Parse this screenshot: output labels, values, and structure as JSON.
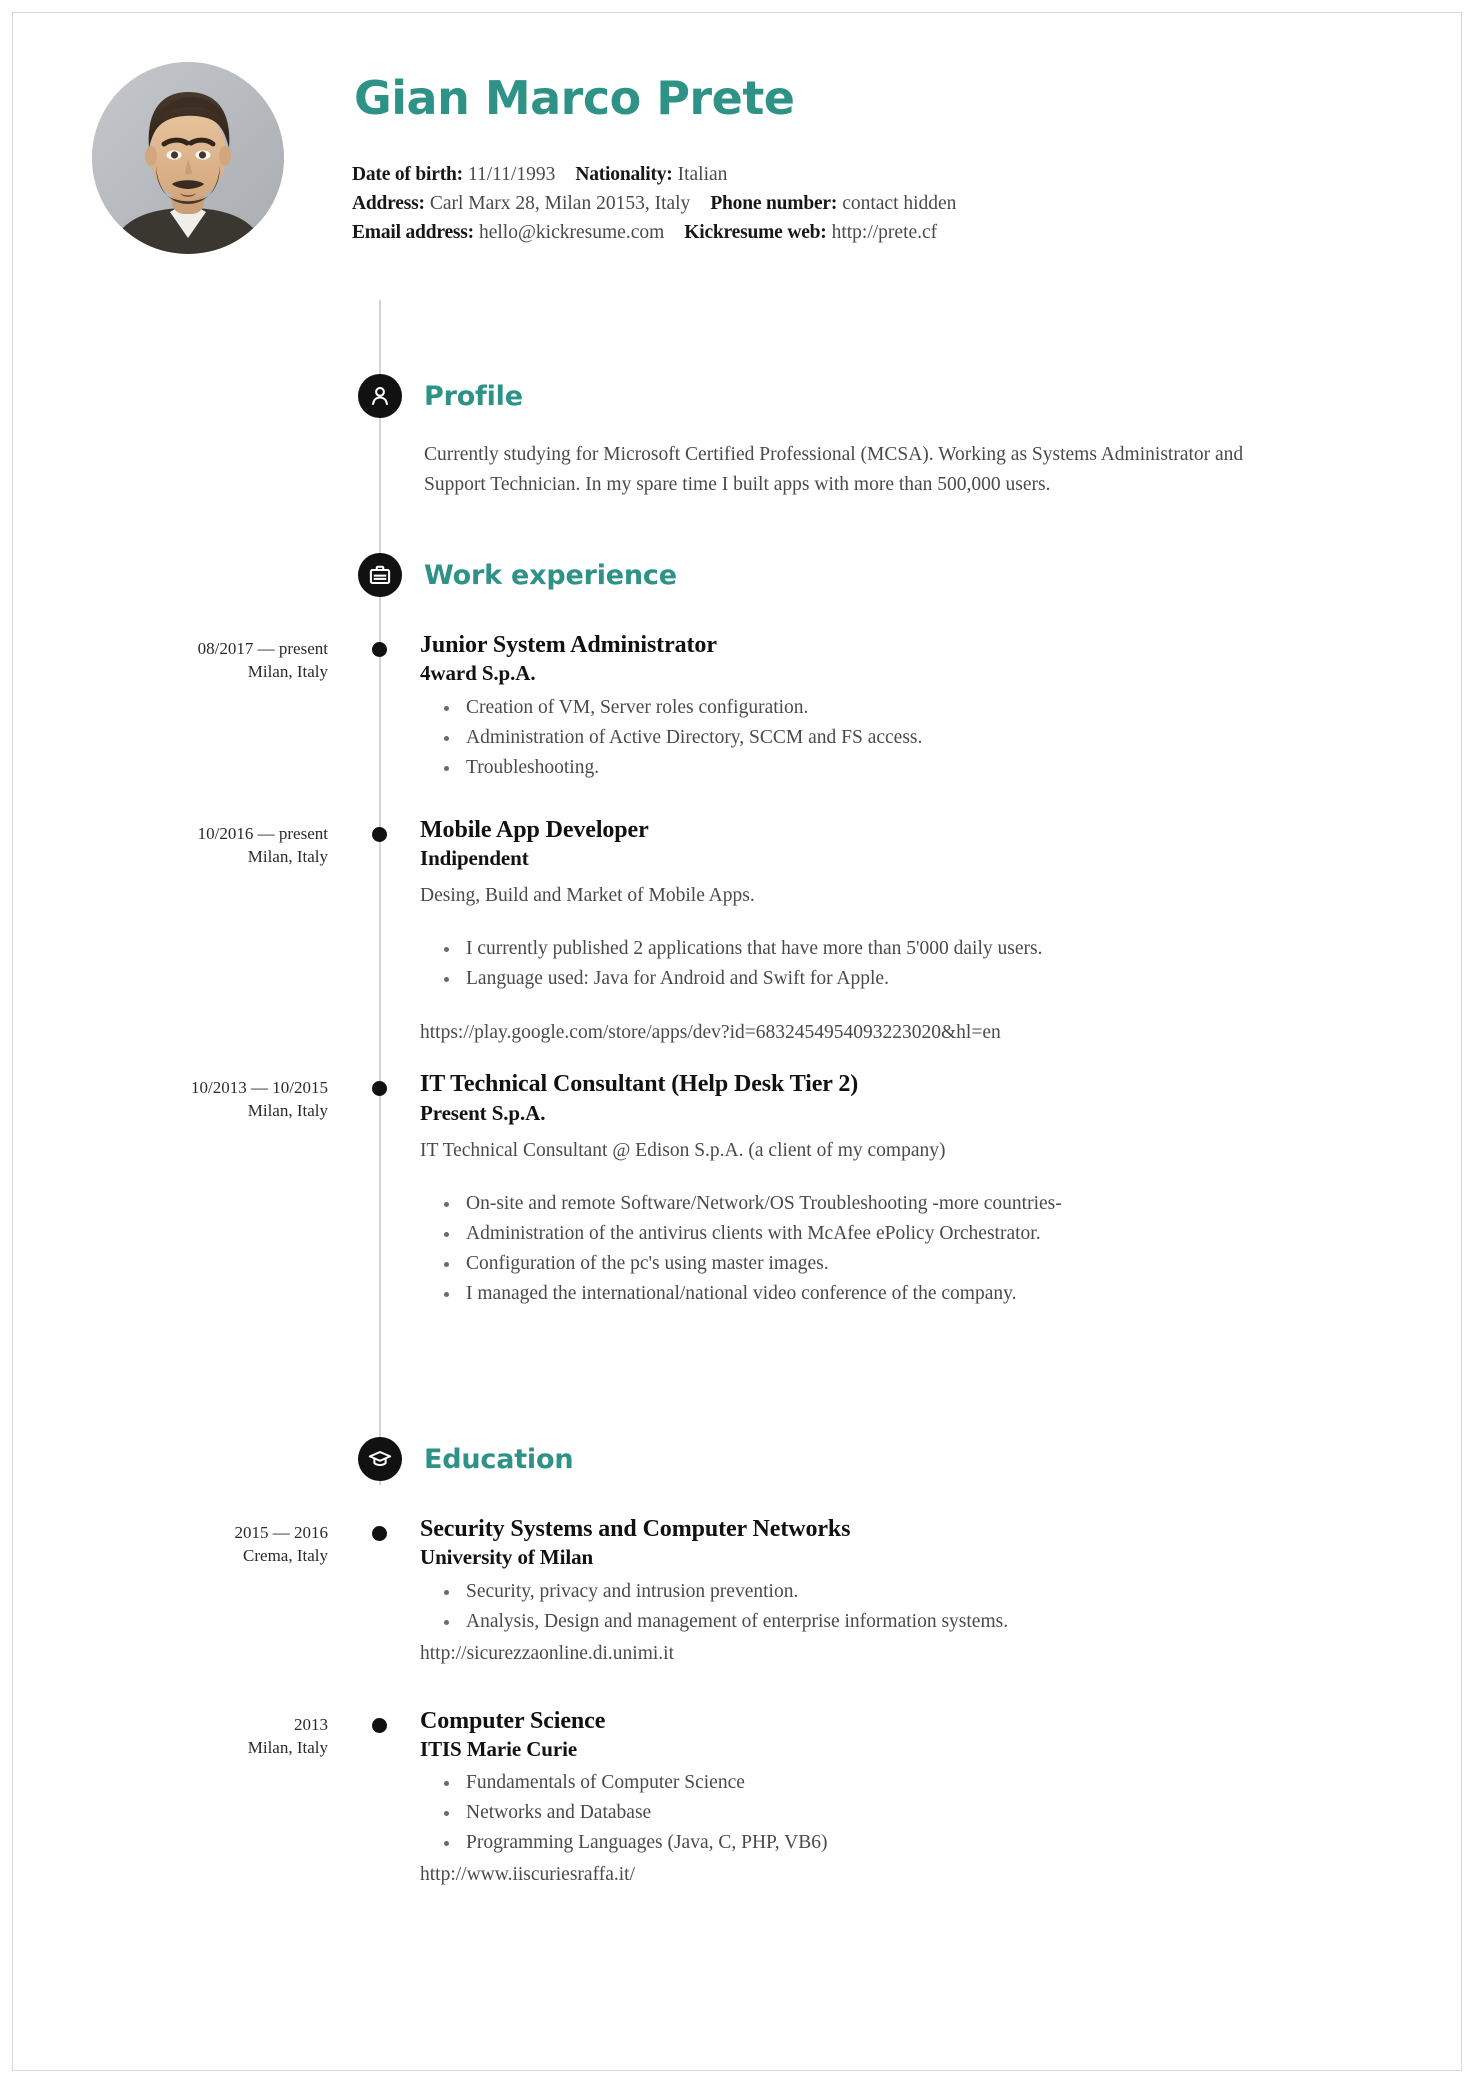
{
  "person": {
    "name": "Gian Marco Prete",
    "photo_alt": "portrait-photo"
  },
  "contact": {
    "dob_label": "Date of birth:",
    "dob_value": "11/11/1993",
    "nationality_label": "Nationality:",
    "nationality_value": "Italian",
    "address_label": "Address:",
    "address_value": "Carl Marx 28, Milan 20153, Italy",
    "phone_label": "Phone number:",
    "phone_value": "contact hidden",
    "email_label": "Email address:",
    "email_value": "hello@kickresume.com",
    "web_label": "Kickresume web:",
    "web_value": "http://prete.cf"
  },
  "sections": {
    "profile": {
      "title": "Profile",
      "icon": "person-icon",
      "text": "Currently studying for Microsoft Certified Professional (MCSA). Working as Systems Administrator and Support Technician. In my spare time I built apps with more than 500,000 users."
    },
    "work": {
      "title": "Work experience",
      "icon": "briefcase-icon",
      "entries": [
        {
          "dates": "08/2017 — present",
          "place": "Milan, Italy",
          "title": "Junior System Administrator",
          "org": "4ward S.p.A.",
          "desc": "",
          "bullets": [
            "Creation of VM, Server roles configuration.",
            "Administration of Active Directory, SCCM and FS access.",
            "Troubleshooting."
          ],
          "link": ""
        },
        {
          "dates": "10/2016 — present",
          "place": "Milan, Italy",
          "title": "Mobile App Developer",
          "org": "Indipendent",
          "desc": "Desing, Build and Market of Mobile Apps.",
          "bullets": [
            "I currently published 2 applications that have more than 5'000 daily users.",
            "Language used: Java for Android and Swift for Apple."
          ],
          "link": "https://play.google.com/store/apps/dev?id=6832454954093223020&hl=en"
        },
        {
          "dates": "10/2013 — 10/2015",
          "place": "Milan, Italy",
          "title": "IT Technical Consultant (Help Desk Tier 2)",
          "org": "Present S.p.A.",
          "desc": "IT Technical Consultant @ Edison S.p.A. (a client of my company)",
          "bullets": [
            "On-site and remote Software/Network/OS Troubleshooting -more countries-",
            "Administration of the antivirus clients with McAfee ePolicy Orchestrator.",
            "Configuration of the pc's using master images.",
            "I managed the international/national video conference of the company."
          ],
          "link": ""
        }
      ]
    },
    "education": {
      "title": "Education",
      "icon": "graduation-cap-icon",
      "entries": [
        {
          "dates": "2015 — 2016",
          "place": "Crema, Italy",
          "title": "Security Systems and Computer Networks",
          "org": "University of Milan",
          "desc": "",
          "bullets": [
            "Security, privacy and intrusion prevention.",
            "Analysis, Design and management of enterprise information systems."
          ],
          "link": "http://sicurezzaonline.di.unimi.it"
        },
        {
          "dates": "2013",
          "place": "Milan, Italy",
          "title": "Computer Science",
          "org": "ITIS Marie Curie",
          "desc": "",
          "bullets": [
            "Fundamentals of Computer Science",
            "Networks and Database",
            "Programming Languages (Java, C, PHP, VB6)"
          ],
          "link": "http://www.iiscuriesraffa.it/"
        }
      ]
    }
  },
  "colors": {
    "accent": "#2e9286",
    "icon_bg": "#111111",
    "text": "#4a4a4a",
    "heading": "#111111",
    "rail": "#d4d4d4"
  }
}
